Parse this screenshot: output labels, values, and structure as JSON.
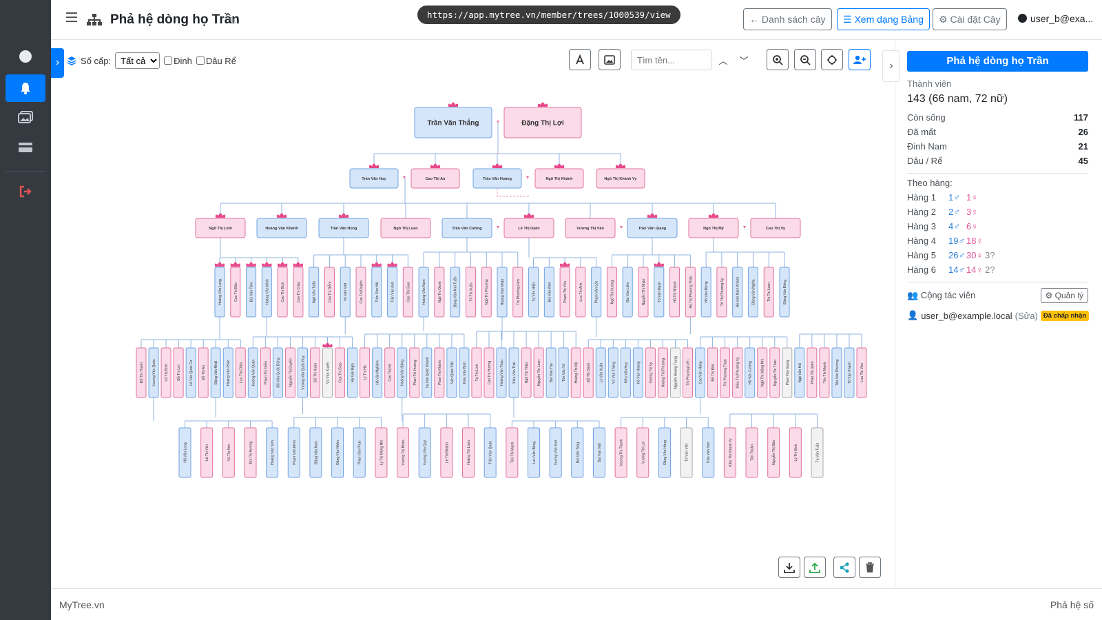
{
  "sidebar": {
    "items": [
      "circle-icon",
      "bell-icon",
      "images-icon",
      "card-icon",
      "logout-icon"
    ]
  },
  "header": {
    "title": "Phả hệ dòng họ Trần",
    "url": "https://app.mytree.vn/member/trees/1000539/view",
    "btn_list": "Danh sách cây",
    "btn_table": "Xem dạng Bảng",
    "btn_settings": "Cài đặt Cây",
    "user": "user_b@exa..."
  },
  "toolbar": {
    "generation_label": "Số cấp:",
    "generation_value": "Tất cả",
    "chk_dinh": "Đinh",
    "chk_dau": "Dâu Rể",
    "search_placeholder": "Tìm tên..."
  },
  "panel": {
    "title": "Phả hệ dòng họ Trần",
    "members_label": "Thành viên",
    "members_value": "143 (66 nam, 72 nữ)",
    "stats": [
      {
        "label": "Còn sống",
        "value": "117"
      },
      {
        "label": "Đã mất",
        "value": "26"
      },
      {
        "label": "Đinh Nam",
        "value": "21"
      },
      {
        "label": "Dâu / Rể",
        "value": "45"
      }
    ],
    "gen_title": "Theo hàng:",
    "generations": [
      {
        "label": "Hàng 1",
        "male": "1♂",
        "female": "1♀",
        "unknown": ""
      },
      {
        "label": "Hàng 2",
        "male": "2♂",
        "female": "3♀",
        "unknown": ""
      },
      {
        "label": "Hàng 3",
        "male": "4♂",
        "female": "6♀",
        "unknown": ""
      },
      {
        "label": "Hàng 4",
        "male": "19♂",
        "female": "18♀",
        "unknown": ""
      },
      {
        "label": "Hàng 5",
        "male": "26♂",
        "female": "30♀",
        "unknown": "3?"
      },
      {
        "label": "Hàng 6",
        "male": "14♂",
        "female": "14♀",
        "unknown": "2?"
      }
    ],
    "collab_title": "Cộng tác viên",
    "manage": "Quản lý",
    "collab_user": "user_b@example.local",
    "collab_edit": "(Sửa)",
    "collab_badge": "Đã chấp nhận"
  },
  "footer": {
    "left": "MyTree.vn",
    "right": "Phả hệ số"
  },
  "colors": {
    "male_fill": "#d6e6fa",
    "male_stroke": "#6fa2e0",
    "female_fill": "#fbdbe8",
    "female_stroke": "#e0709f",
    "unknown_fill": "#f2f2f2",
    "lotus": "#e8488a"
  },
  "tree": {
    "gen1": [
      {
        "name": "Trần Văn Thắng",
        "g": "m"
      },
      {
        "name": "Đặng Thị Lợi",
        "g": "f"
      }
    ],
    "gen2": [
      {
        "name": "Trần Văn Huy",
        "g": "m"
      },
      {
        "name": "Cao Thị An",
        "g": "f"
      },
      {
        "name": "Trần Văn Hoàng",
        "g": "m"
      },
      {
        "name": "Ngô Thị Khánh",
        "g": "f"
      },
      {
        "name": "Ngô Thị Khánh Vy",
        "g": "f"
      }
    ],
    "gen3": [
      {
        "name": "Ngô Thị Linh",
        "g": "f"
      },
      {
        "name": "Hoàng Văn Khánh",
        "g": "m"
      },
      {
        "name": "Trần Văn Hùng",
        "g": "m"
      },
      {
        "name": "Ngô Thị Loan",
        "g": "f"
      },
      {
        "name": "Trần Văn Cường",
        "g": "m"
      },
      {
        "name": "Lê Thị Uyên",
        "g": "f"
      },
      {
        "name": "Vương Thị Vân",
        "g": "f"
      },
      {
        "name": "Trần Văn Giang",
        "g": "m"
      },
      {
        "name": "Ngô Thị Mỹ",
        "g": "f"
      },
      {
        "name": "Cao Thị Vy",
        "g": "f"
      }
    ],
    "gen4": [
      {
        "name": "Hoàng Văn Long",
        "g": "m"
      },
      {
        "name": "Cao Thị Bảo",
        "g": "f"
      },
      {
        "name": "Bùi Văn Tâm",
        "g": "m"
      },
      {
        "name": "Hoàng Văn Minh",
        "g": "m"
      },
      {
        "name": "Cao Thị Bích",
        "g": "f"
      },
      {
        "name": "Cao Thị Châu",
        "g": "f"
      },
      {
        "name": "Ngô Văn Tuấn",
        "g": "m"
      },
      {
        "name": "Cao Thị Diễm",
        "g": "f"
      },
      {
        "name": "Vũ Văn Việt",
        "g": "m"
      },
      {
        "name": "Cao Thị Duyên",
        "g": "f"
      },
      {
        "name": "Trần Văn Hải",
        "g": "m"
      },
      {
        "name": "Trần Văn Anh",
        "g": "m"
      },
      {
        "name": "Cao Thị Giao",
        "g": "f"
      },
      {
        "name": "Hoàng Văn Nam",
        "g": "m"
      },
      {
        "name": "Ngô Thị Oanh",
        "g": "f"
      },
      {
        "name": "Đặng Văn Anh Tuấn",
        "g": "m"
      },
      {
        "name": "Tô Thị Xuân",
        "g": "f"
      },
      {
        "name": "Ngô Thị Phương",
        "g": "f"
      },
      {
        "name": "Hoàng Văn Nhân",
        "g": "m"
      },
      {
        "name": "Thị Phương Liên",
        "g": "f"
      },
      {
        "name": "Tạ Văn Hiệp",
        "g": "m"
      },
      {
        "name": "Bùi Văn Kiên",
        "g": "m"
      },
      {
        "name": "Phạm Thị Yến",
        "g": "f"
      },
      {
        "name": "Lưu Thị Anh",
        "g": "f"
      },
      {
        "name": "Phạm Văn Lộc",
        "g": "m"
      },
      {
        "name": "Ngô Thị Hương",
        "g": "f"
      },
      {
        "name": "Bùi Văn Liêm",
        "g": "m"
      },
      {
        "name": "Nguyễn Thị Nhàn",
        "g": "f"
      },
      {
        "name": "Tô Văn Mạnh",
        "g": "m"
      },
      {
        "name": "Hồ Thị Nhành",
        "g": "f"
      },
      {
        "name": "Hồ Thị Phương Thảo",
        "g": "f"
      },
      {
        "name": "Hồ Văn Mừng",
        "g": "m"
      },
      {
        "name": "Tô Thị Phương Vy",
        "g": "f"
      },
      {
        "name": "Hồ Văn Nam Khánh",
        "g": "m"
      },
      {
        "name": "Đặng Văn Nghĩa",
        "g": "m"
      },
      {
        "name": "Thị Thị Loan",
        "g": "f"
      },
      {
        "name": "Đặng Văn Đông",
        "g": "m"
      }
    ],
    "gen5": [
      {
        "name": "Đỗ Thị Thanh",
        "g": "f"
      },
      {
        "name": "Vương Văn Quốc",
        "g": "m"
      },
      {
        "name": "Vũ Thị Bích",
        "g": "f"
      },
      {
        "name": "Đỗ Thị Lợi",
        "g": "f"
      },
      {
        "name": "Lê Văn Quốc Cơ",
        "g": "m"
      },
      {
        "name": "Đỗ Thị An",
        "g": "f"
      },
      {
        "name": "Đặng Văn Nhật",
        "g": "m"
      },
      {
        "name": "Hoàng Văn Phúc",
        "g": "m"
      },
      {
        "name": "Lưu Thị Châu",
        "g": "f"
      },
      {
        "name": "Hoàng Văn Quân",
        "g": "m"
      },
      {
        "name": "Phạm Thị Diễm",
        "g": "f"
      },
      {
        "name": "Đỗ Văn Quốc Dũng",
        "g": "m"
      },
      {
        "name": "Nguyễn Thị Duyên",
        "g": "f"
      },
      {
        "name": "Vương Văn Quốc Huy",
        "g": "m"
      },
      {
        "name": "Đỗ Thị Xuân",
        "g": "f"
      },
      {
        "name": "Vũ Văn Xuyên",
        "g": "u"
      },
      {
        "name": "Cao Thị Giao",
        "g": "f"
      },
      {
        "name": "Hà Văn Nghị",
        "g": "m"
      },
      {
        "name": "Lý Thị Hà",
        "g": "f"
      },
      {
        "name": "Hà Văn Nghiêm",
        "g": "m"
      },
      {
        "name": "Cao Thị Hà",
        "g": "f"
      },
      {
        "name": "Hoàng Văn Bông",
        "g": "m"
      },
      {
        "name": "Phan Thị Hương",
        "g": "f"
      },
      {
        "name": "Tạ Văn Quốc Khánh",
        "g": "m"
      },
      {
        "name": "Phan Thị Khánh",
        "g": "f"
      },
      {
        "name": "Văn Quốc Việt",
        "g": "m"
      },
      {
        "name": "Kiều Văn Bình",
        "g": "m"
      },
      {
        "name": "Tạ Thị Linh",
        "g": "f"
      },
      {
        "name": "Cao Thị Hương",
        "g": "f"
      },
      {
        "name": "Hoàng Văn Thạo",
        "g": "m"
      },
      {
        "name": "Kiều Văn Thái",
        "g": "m"
      },
      {
        "name": "Ngô Thị Thảo",
        "g": "f"
      },
      {
        "name": "Nguyễn Thị Loan",
        "g": "f"
      },
      {
        "name": "Bùi Văn Thọ",
        "g": "m"
      },
      {
        "name": "Tôn Văn Vũ",
        "g": "m"
      },
      {
        "name": "Hoàng Thị Mỹ",
        "g": "f"
      },
      {
        "name": "Đỗ Thị Oanh",
        "g": "f"
      },
      {
        "name": "Lý Văn Xuân",
        "g": "m"
      },
      {
        "name": "Vũ Văn Thắng",
        "g": "m"
      },
      {
        "name": "Kiều Văn Huy",
        "g": "m"
      },
      {
        "name": "Hồ Văn Hoàng",
        "g": "m"
      },
      {
        "name": "Vương Thị Vy",
        "g": "f"
      },
      {
        "name": "Hoàng Thị Phương",
        "g": "f"
      },
      {
        "name": "Nguyễn Hoàng Trung",
        "g": "u"
      },
      {
        "name": "Thị Phương Liên",
        "g": "f"
      },
      {
        "name": "Cao Văn Hùng",
        "g": "m"
      },
      {
        "name": "Đỗ Thị Bảo",
        "g": "f"
      },
      {
        "name": "Thị Phương Thảo",
        "g": "f"
      },
      {
        "name": "Kiều Thị Phương Vy",
        "g": "f"
      },
      {
        "name": "Hồ Văn Cường",
        "g": "m"
      },
      {
        "name": "Ngô Thị Mộng Nhi",
        "g": "f"
      },
      {
        "name": "Nguyễn Thị Thảo",
        "g": "f"
      },
      {
        "name": "Phan Văn Giang",
        "g": "u"
      },
      {
        "name": "Ngô Văn Hải",
        "g": "m"
      },
      {
        "name": "Phan Thị Uyên",
        "g": "f"
      },
      {
        "name": "Tôn Thị Mạnh",
        "g": "f"
      },
      {
        "name": "Tôn Văn Phương",
        "g": "m"
      },
      {
        "name": "Tô Văn Khánh",
        "g": "m"
      },
      {
        "name": "Lưu Thị Vân",
        "g": "f"
      }
    ],
    "gen6": [
      {
        "name": "Hồ Văn Long",
        "g": "m"
      },
      {
        "name": "Lê Thị Yến",
        "g": "f"
      },
      {
        "name": "Vũ Thị Anh",
        "g": "f"
      },
      {
        "name": "Bùi Thị Hương",
        "g": "f"
      },
      {
        "name": "Hoàng Văn Sơn",
        "g": "m"
      },
      {
        "name": "Phạm Văn Minh",
        "g": "m"
      },
      {
        "name": "Đặng Văn Nam",
        "g": "m"
      },
      {
        "name": "Đặng Văn Nhân",
        "g": "m"
      },
      {
        "name": "Phan Văn Phúc",
        "g": "m"
      },
      {
        "name": "Lý Thị Mộng Nhi",
        "g": "f"
      },
      {
        "name": "Vương Thị Nhàn",
        "g": "f"
      },
      {
        "name": "Vương Văn Quý",
        "g": "m"
      },
      {
        "name": "Lê Thị Nhành",
        "g": "f"
      },
      {
        "name": "Hoàng Thị Loan",
        "g": "f"
      },
      {
        "name": "Trần Văn Quân",
        "g": "m"
      },
      {
        "name": "Tôn Thị Mạnh",
        "g": "f"
      },
      {
        "name": "Lưu Văn Bông",
        "g": "m"
      },
      {
        "name": "Vương Văn Sơn",
        "g": "m"
      },
      {
        "name": "Bùi Văn Tùng",
        "g": "m"
      },
      {
        "name": "Bùi Văn Việt",
        "g": "m"
      },
      {
        "name": "Vương Thị Thanh",
        "g": "f"
      },
      {
        "name": "Vương Thị Lợi",
        "g": "f"
      },
      {
        "name": "Đặng Văn Hùng",
        "g": "m"
      },
      {
        "name": "Tô Văn Việt",
        "g": "u"
      },
      {
        "name": "Trần Văn Sơn",
        "g": "m"
      },
      {
        "name": "Kiều Thị Khánh Vy",
        "g": "f"
      },
      {
        "name": "Tôn Thị An",
        "g": "f"
      },
      {
        "name": "Nguyễn Thị Bảo",
        "g": "f"
      },
      {
        "name": "Lý Thị Bích",
        "g": "f"
      },
      {
        "name": "Tạ Văn Tuấn",
        "g": "u"
      }
    ]
  }
}
